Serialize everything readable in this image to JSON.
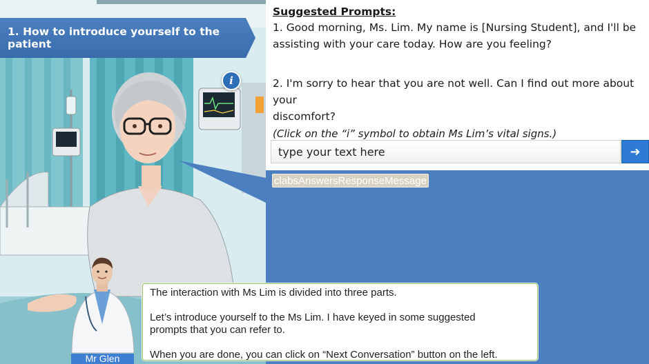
{
  "step_banner": {
    "label": "1. How to introduce yourself to the patient"
  },
  "info_button": {
    "icon": "info-icon",
    "glyph": "i"
  },
  "suggested_prompts": {
    "title": "Suggested Prompts:",
    "prompt1_line1": "1. Good morning, Ms. Lim. My name is [Nursing Student], and I'll be",
    "prompt1_line2": "assisting with your care today. How are you feeling?",
    "prompt2_line1": "2. I'm sorry to hear that you are not well. Can I find out more about your",
    "prompt2_line2": "discomfort?",
    "hint": "(Click on the “i” symbol to obtain Ms Lim’s vital signs.)"
  },
  "chat_input": {
    "placeholder": "type your text here",
    "send_icon": "arrow-right-icon",
    "send_glyph": "➜"
  },
  "response": {
    "tag": "clabsAnswersResponseMessage"
  },
  "guide": {
    "name": "Mr Glen",
    "line1": "The interaction with Ms Lim is divided into three parts.",
    "line2": "Let’s introduce yourself to the Ms Lim. I have keyed in some suggested",
    "line3": "prompts that you can refer to.",
    "line4": "When you are done, you can click on “Next Conversation” button on the left."
  },
  "colors": {
    "banner": "#3f74b6",
    "response_panel": "#4b7fc0",
    "send_button": "#2e7bd3",
    "guide_border": "#9bc46a",
    "curtain": "#5fb8c3"
  }
}
